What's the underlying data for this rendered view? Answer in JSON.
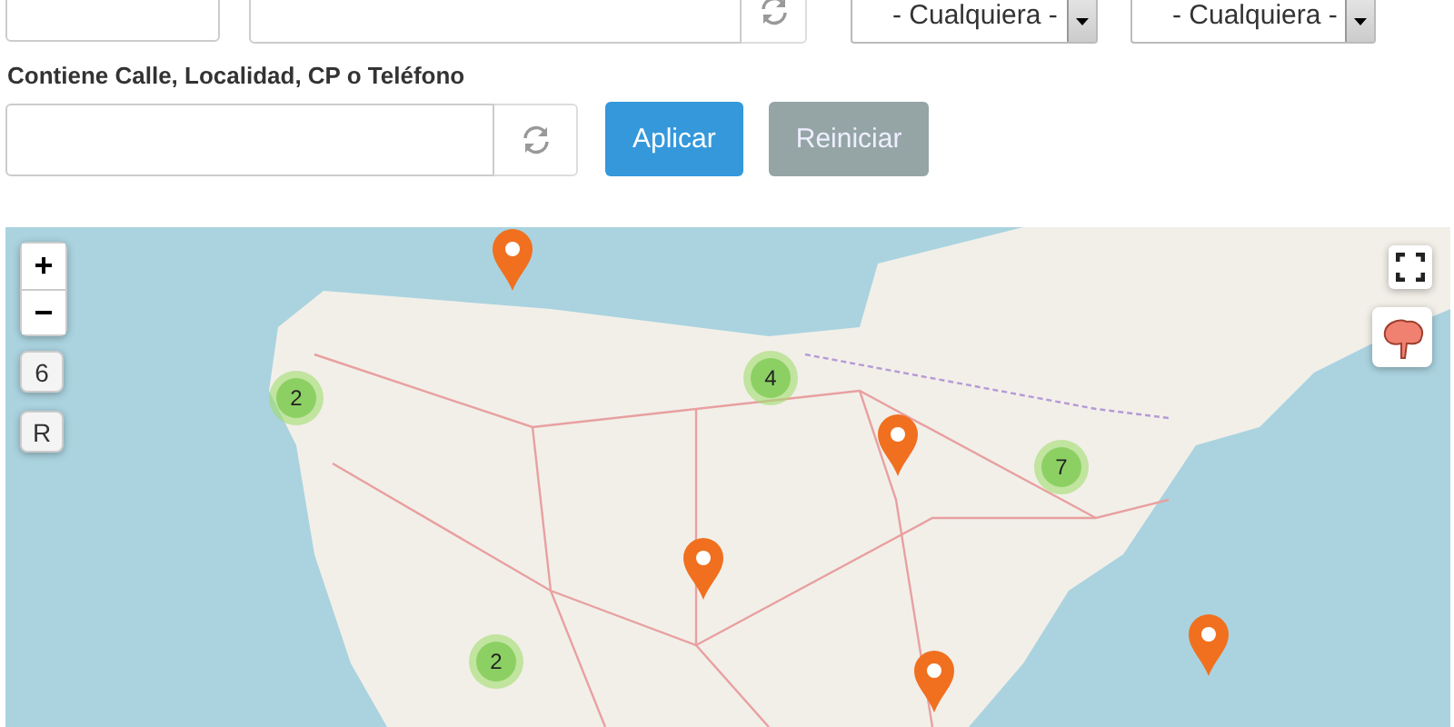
{
  "filters": {
    "selects": [
      {
        "value": "- Cualquiera -"
      },
      {
        "value": "- Cualquiera -"
      }
    ]
  },
  "search": {
    "label": "Contiene Calle, Localidad, CP o Teléfono"
  },
  "buttons": [
    {
      "label": "Aplicar",
      "kind": "primary"
    },
    {
      "label": "Reiniciar",
      "kind": "secondary"
    }
  ],
  "map": {
    "zoom_in": "+",
    "zoom_out": "−",
    "zoom_level": "6",
    "reset": "R",
    "clusters": [
      {
        "count": "2"
      },
      {
        "count": "4"
      },
      {
        "count": "7"
      },
      {
        "count": "2"
      }
    ]
  }
}
